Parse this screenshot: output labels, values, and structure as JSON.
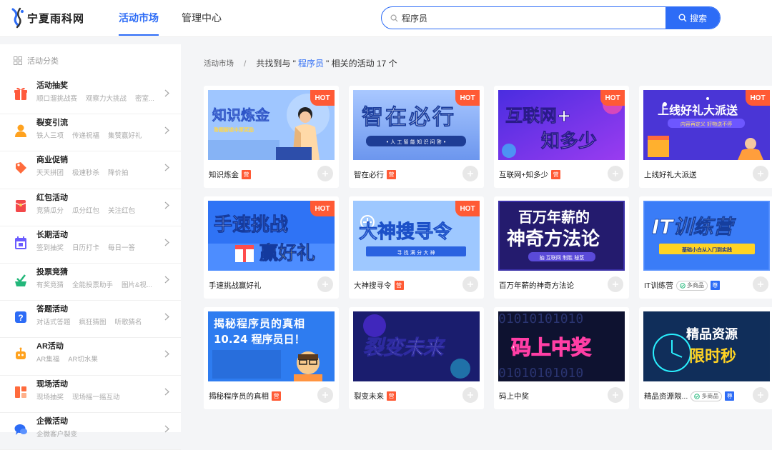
{
  "header": {
    "logo_text": "宁夏雨科网",
    "nav": [
      {
        "label": "活动市场",
        "active": true
      },
      {
        "label": "管理中心",
        "active": false
      }
    ],
    "search": {
      "value": "程序员",
      "button_label": "搜索"
    }
  },
  "sidebar": {
    "title": "活动分类",
    "items": [
      {
        "label": "活动抽奖",
        "subs": [
          "顺口溜挑战赛",
          "观察力大挑战",
          "密室..."
        ],
        "icon": "gift-icon",
        "color": "#ff5a3c"
      },
      {
        "label": "裂变引流",
        "subs": [
          "铁人三项",
          "传递祝福",
          "集赞赢好礼"
        ],
        "icon": "user-icon",
        "color": "#ffa21f"
      },
      {
        "label": "商业促销",
        "subs": [
          "天天拼团",
          "极速秒杀",
          "降价拍"
        ],
        "icon": "tag-icon",
        "color": "#ff6b3c"
      },
      {
        "label": "红包活动",
        "subs": [
          "竞猜瓜分",
          "瓜分红包",
          "关注红包"
        ],
        "icon": "red-envelope-icon",
        "color": "#f3484a"
      },
      {
        "label": "长期活动",
        "subs": [
          "签到抽奖",
          "日历打卡",
          "每日一答"
        ],
        "icon": "calendar-icon",
        "color": "#6b5cff"
      },
      {
        "label": "投票竞猜",
        "subs": [
          "有奖竞猜",
          "全能投票助手",
          "图片&视..."
        ],
        "icon": "vote-icon",
        "color": "#23b77a"
      },
      {
        "label": "答题活动",
        "subs": [
          "对话式答题",
          "疯狂猜图",
          "听歌猜名"
        ],
        "icon": "question-icon",
        "color": "#2d6cf6"
      },
      {
        "label": "AR活动",
        "subs": [
          "AR集福",
          "AR切水果"
        ],
        "icon": "robot-icon",
        "color": "#ffa21f"
      },
      {
        "label": "现场活动",
        "subs": [
          "现场抽奖",
          "现场摇一摇互动"
        ],
        "icon": "grid-icon",
        "color": "#ff6b3c"
      },
      {
        "label": "企微活动",
        "subs": [
          "企微客户裂变"
        ],
        "icon": "chat-icon",
        "color": "#2d6cf6"
      }
    ]
  },
  "breadcrumb": {
    "root": "活动市场",
    "sep": "/",
    "prefix": "共找到与 \"",
    "keyword": "程序员",
    "suffix": "\" 相关的活动 17 个"
  },
  "cards": [
    {
      "title": "知识炼金",
      "hot": true,
      "tag": "营",
      "banner": "知识炼金",
      "banner_sub": "答题解锁丰厚奖励",
      "theme": "a"
    },
    {
      "title": "智在必行",
      "hot": true,
      "tag": "营",
      "banner": "智在必行",
      "banner_sub": "• 人 工 智 能 知 识 问 答 •",
      "theme": "b"
    },
    {
      "title": "互联网+知多少",
      "hot": true,
      "tag": "营",
      "banner": "互联网+",
      "banner2": "知多少",
      "theme": "c"
    },
    {
      "title": "上线好礼大派送",
      "hot": true,
      "tag": "",
      "banner": "上线好礼大派送",
      "banner_sub": "内容再定义 好物送不停",
      "theme": "d"
    },
    {
      "title": "手速挑战赢好礼",
      "hot": true,
      "tag": "",
      "banner": "手速挑战",
      "banner2": "赢好礼",
      "theme": "e"
    },
    {
      "title": "大神搜寻令",
      "hot": true,
      "tag": "营",
      "banner": "大神搜寻令",
      "banner_sub": "寻 找 满 分 大 神",
      "theme": "f"
    },
    {
      "title": "百万年薪的神奇方法论",
      "hot": false,
      "tag": "",
      "banner": "百万年薪的",
      "banner2": "神奇方法论",
      "banner_sub": "抽 互联网 制胜 秘笈",
      "theme": "g"
    },
    {
      "title": "IT训练营",
      "hot": false,
      "tag": "多商品",
      "tag2": "尊",
      "banner": "IT训练营",
      "banner_sub": "基础小白从入门到实践",
      "theme": "h"
    },
    {
      "title": "揭秘程序员的真相",
      "hot": false,
      "tag": "营",
      "banner": "揭秘程序员的真相",
      "banner2": "10.24 程序员日！",
      "theme": "i"
    },
    {
      "title": "裂变未来",
      "hot": false,
      "tag": "营",
      "banner": "裂变未来",
      "theme": "j"
    },
    {
      "title": "码上中奖",
      "hot": false,
      "tag": "",
      "banner": "码上中奖",
      "banner_bg": "01010101010",
      "theme": "k"
    },
    {
      "title": "精品资源限...",
      "hot": false,
      "tag": "多商品",
      "tag2": "尊",
      "banner": "精品资源",
      "banner2": "限时秒",
      "theme": "l"
    }
  ],
  "labels": {
    "hot": "HOT"
  }
}
